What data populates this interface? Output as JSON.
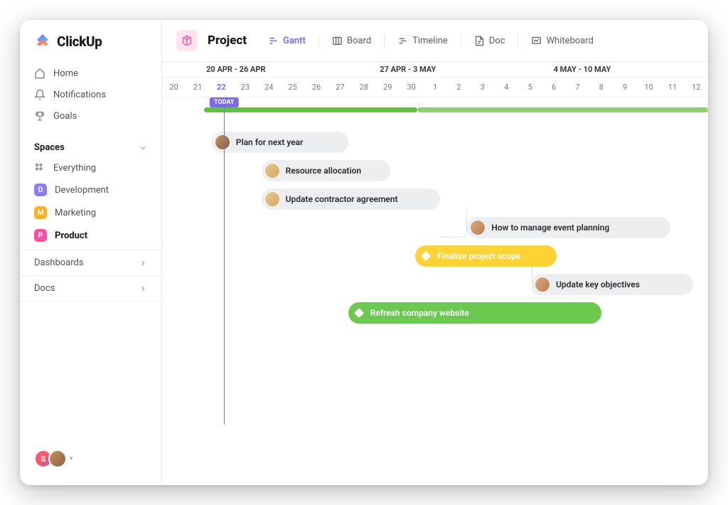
{
  "brand": "ClickUp",
  "nav": {
    "home": "Home",
    "notifications": "Notifications",
    "goals": "Goals"
  },
  "spaces": {
    "header": "Spaces",
    "everything": "Everything",
    "items": [
      {
        "label": "Development",
        "badge": "D",
        "color": "#8c7bff"
      },
      {
        "label": "Marketing",
        "badge": "M",
        "color": "#ffb020"
      },
      {
        "label": "Product",
        "badge": "P",
        "color": "#ff4fa3"
      }
    ]
  },
  "sections": {
    "dashboards": "Dashboards",
    "docs": "Docs"
  },
  "footer": {
    "initial": "S"
  },
  "header": {
    "project": "Project",
    "views": {
      "gantt": "Gantt",
      "board": "Board",
      "timeline": "Timeline",
      "doc": "Doc",
      "whiteboard": "Whiteboard"
    }
  },
  "timeline": {
    "weeks": [
      {
        "label": "20 APR - 26 APR",
        "span": 7,
        "offset": 0
      },
      {
        "label": "27 APR - 3 MAY",
        "span": 7,
        "offset": 7
      },
      {
        "label": "4 MAY - 10 MAY",
        "span": 7,
        "offset": 14
      }
    ],
    "days": [
      "20",
      "21",
      "22",
      "23",
      "24",
      "25",
      "26",
      "27",
      "28",
      "29",
      "30",
      "1",
      "2",
      "3",
      "4",
      "5",
      "6",
      "7",
      "8",
      "9",
      "10",
      "11",
      "12"
    ],
    "today_index": 2,
    "today_label": "TODAY"
  },
  "tasks": [
    {
      "label": "Plan for next year",
      "type": "avatar",
      "avatar_bg": "linear-gradient(135deg,#c89060,#8b6040)",
      "start": 2,
      "span": 5.5,
      "row": 0,
      "color": "gray"
    },
    {
      "label": "Resource allocation",
      "type": "avatar",
      "avatar_bg": "linear-gradient(135deg,#e8c890,#d4a860)",
      "start": 4,
      "span": 5.2,
      "row": 1,
      "color": "gray"
    },
    {
      "label": "Update contractor agreement",
      "type": "avatar",
      "avatar_bg": "linear-gradient(135deg,#e8c890,#d4a860)",
      "start": 4,
      "span": 7.2,
      "row": 2,
      "color": "gray"
    },
    {
      "label": "How to manage event planning",
      "type": "avatar",
      "avatar_bg": "linear-gradient(135deg,#d8a880,#b88050)",
      "start": 12.3,
      "span": 8.2,
      "row": 3,
      "color": "gray"
    },
    {
      "label": "Finalize project scope",
      "type": "diamond",
      "start": 10.2,
      "span": 5.7,
      "row": 4,
      "color": "yellow"
    },
    {
      "label": "Update key objectives",
      "type": "avatar",
      "avatar_bg": "linear-gradient(135deg,#d8a880,#b88050)",
      "start": 14.9,
      "span": 6.5,
      "row": 5,
      "color": "gray"
    },
    {
      "label": "Refresh company website",
      "type": "diamond",
      "start": 7.5,
      "span": 10.2,
      "row": 6,
      "color": "green"
    }
  ]
}
